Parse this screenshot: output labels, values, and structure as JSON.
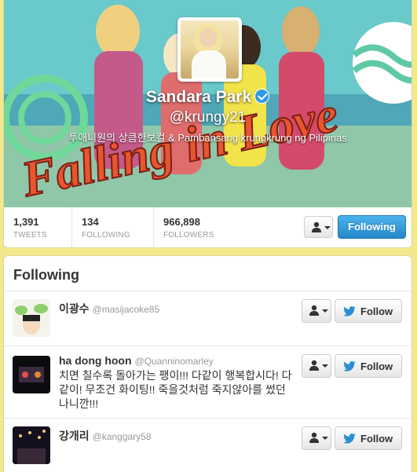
{
  "profile": {
    "display_name": "Sandara Park",
    "screen_name": "@krungy21",
    "bio": "투애니원의 상큼한보컬 & Pambansang krungkrung ng Pilipinas",
    "banner_text": "Falling in Love",
    "verified_icon": "verified-badge-icon",
    "stats": [
      {
        "value": "1,391",
        "label": "TWEETS"
      },
      {
        "value": "134",
        "label": "FOLLOWING"
      },
      {
        "value": "966,898",
        "label": "FOLLOWERS"
      }
    ],
    "following_label": "Following",
    "accent_color": "#2a8fd4"
  },
  "following": {
    "title": "Following",
    "follow_label": "Follow",
    "users": [
      {
        "name": "이광수",
        "handle": "@masijacoke85",
        "bio": ""
      },
      {
        "name": "ha dong hoon",
        "handle": "@Quanninomarley",
        "bio": "치면 칠수록 돌아가는 팽이!!! 다같이 행복합시다! 다같이! 무조건 화이팅!! 죽을것처럼 죽지않아를 썼던 나니깐!!!"
      },
      {
        "name": "강개리",
        "handle": "@kanggary58",
        "bio": ""
      }
    ]
  }
}
